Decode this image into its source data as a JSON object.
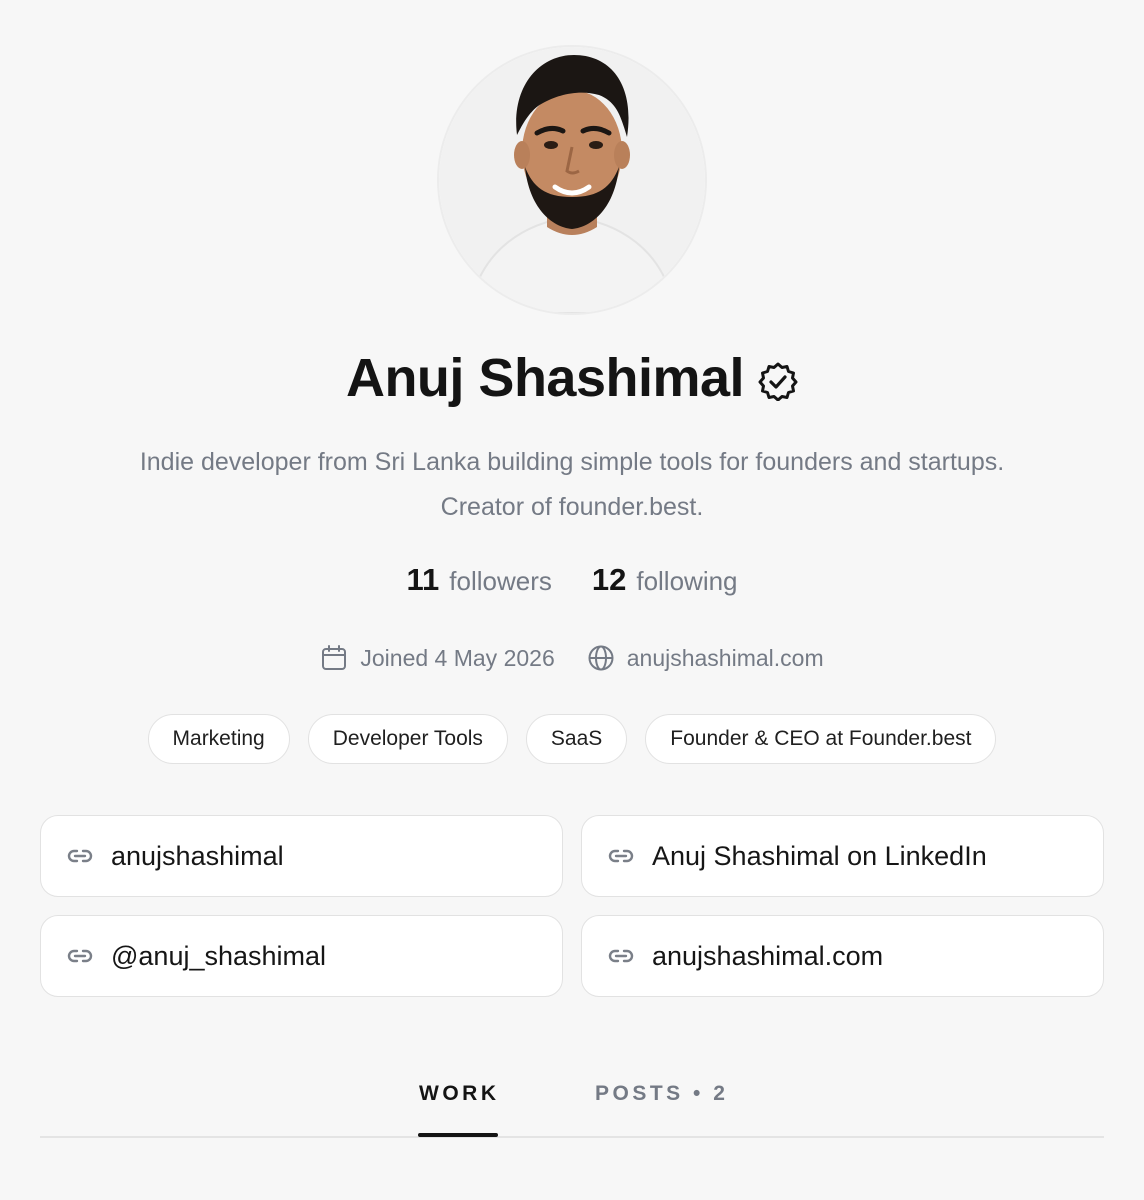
{
  "profile": {
    "name": "Anuj Shashimal",
    "verified_icon": "verified-badge-icon",
    "bio_line1": "Indie developer from Sri Lanka building simple tools for founders and startups.",
    "bio_line2": "Creator of founder.best."
  },
  "stats": {
    "followers_count": "11",
    "followers_label": "followers",
    "following_count": "12",
    "following_label": "following"
  },
  "meta": {
    "joined": "Joined 4 May 2026",
    "website": "anujshashimal.com"
  },
  "tags": [
    "Marketing",
    "Developer Tools",
    "SaaS",
    "Founder & CEO at Founder.best"
  ],
  "links": [
    "anujshashimal",
    "Anuj Shashimal on LinkedIn",
    "@anuj_shashimal",
    "anujshashimal.com"
  ],
  "tabs": {
    "work": "WORK",
    "posts": "POSTS • 2",
    "active": "work"
  },
  "colors": {
    "background": "#f7f7f7",
    "text": "#141414",
    "muted": "#747a85",
    "border": "#e2e2e2"
  }
}
